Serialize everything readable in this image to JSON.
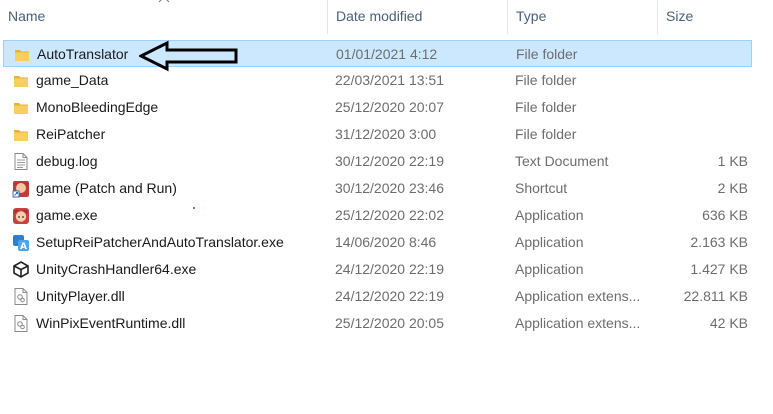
{
  "columns": {
    "name": "Name",
    "date": "Date modified",
    "type": "Type",
    "size": "Size"
  },
  "files": [
    {
      "name": "AutoTranslator",
      "date": "01/01/2021 4:12",
      "type": "File folder",
      "size": "",
      "icon": "folder-icon"
    },
    {
      "name": "game_Data",
      "date": "22/03/2021 13:51",
      "type": "File folder",
      "size": "",
      "icon": "folder-icon"
    },
    {
      "name": "MonoBleedingEdge",
      "date": "25/12/2020 20:07",
      "type": "File folder",
      "size": "",
      "icon": "folder-icon"
    },
    {
      "name": "ReiPatcher",
      "date": "31/12/2020 3:00",
      "type": "File folder",
      "size": "",
      "icon": "folder-icon"
    },
    {
      "name": "debug.log",
      "date": "30/12/2020 22:19",
      "type": "Text Document",
      "size": "1 KB",
      "icon": "text-document-icon"
    },
    {
      "name": "game (Patch and Run)",
      "date": "30/12/2020 23:46",
      "type": "Shortcut",
      "size": "2 KB",
      "icon": "game-shortcut-icon"
    },
    {
      "name": "game.exe",
      "date": "25/12/2020 22:02",
      "type": "Application",
      "size": "636 KB",
      "icon": "game-app-icon"
    },
    {
      "name": "SetupReiPatcherAndAutoTranslator.exe",
      "date": "14/06/2020 8:46",
      "type": "Application",
      "size": "2.163 KB",
      "icon": "translator-app-icon"
    },
    {
      "name": "UnityCrashHandler64.exe",
      "date": "24/12/2020 22:19",
      "type": "Application",
      "size": "1.427 KB",
      "icon": "unity-icon"
    },
    {
      "name": "UnityPlayer.dll",
      "date": "24/12/2020 22:19",
      "type": "Application extens...",
      "size": "22.811 KB",
      "icon": "dll-icon"
    },
    {
      "name": "WinPixEventRuntime.dll",
      "date": "25/12/2020 20:05",
      "type": "Application extens...",
      "size": "42 KB",
      "icon": "dll-icon"
    }
  ],
  "selected_index": 0,
  "colors": {
    "selection_bg": "#cce8ff",
    "selection_border": "#99d1ff",
    "header_text": "#4c607a",
    "folder": "#f5c64a",
    "annotation_arrow": "#000000"
  }
}
